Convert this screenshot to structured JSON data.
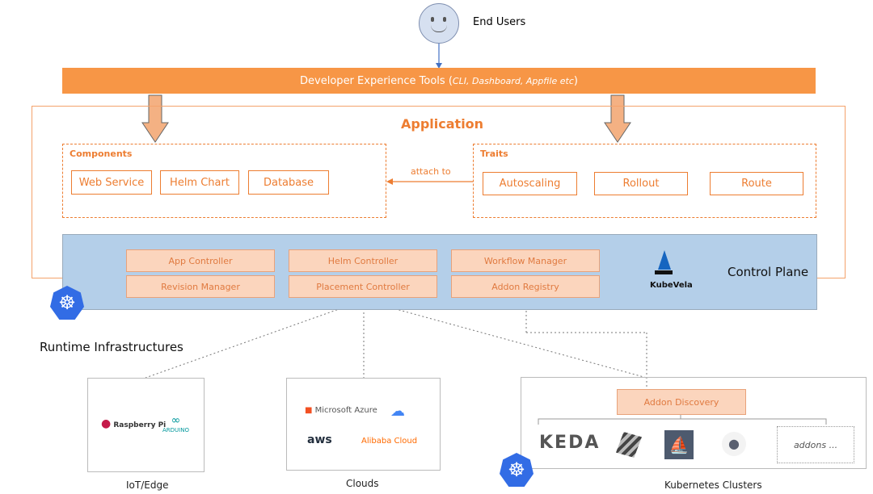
{
  "end_users": "End Users",
  "devtools": {
    "title": "Developer Experience Tools (",
    "italic": "CLI, Dashboard, Appfile etc",
    "close": ")"
  },
  "application": "Application",
  "components": {
    "title": "Components",
    "items": [
      "Web Service",
      "Helm Chart",
      "Database"
    ]
  },
  "attach_to": "attach to",
  "traits": {
    "title": "Traits",
    "items": [
      "Autoscaling",
      "Rollout",
      "Route"
    ]
  },
  "control_plane": {
    "label": "Control Plane",
    "brand": "KubeVela",
    "controllers": [
      "App Controller",
      "Helm Controller",
      "Workflow Manager",
      "Revision Manager",
      "Placement Controller",
      "Addon Registry"
    ]
  },
  "runtime": "Runtime Infrastructures",
  "iot": {
    "label": "IoT/Edge",
    "logos": [
      "Raspberry Pi",
      "ARDUINO"
    ]
  },
  "clouds": {
    "label": "Clouds",
    "logos": [
      "Microsoft Azure",
      "aws",
      "Alibaba Cloud"
    ]
  },
  "k8s": {
    "label": "Kubernetes Clusters",
    "discovery": "Addon Discovery",
    "addons": [
      "KEDA"
    ],
    "more": "addons ..."
  },
  "colors": {
    "orange": "#ed7d31",
    "blue": "#b4cfe9",
    "k8s": "#326ce5"
  }
}
